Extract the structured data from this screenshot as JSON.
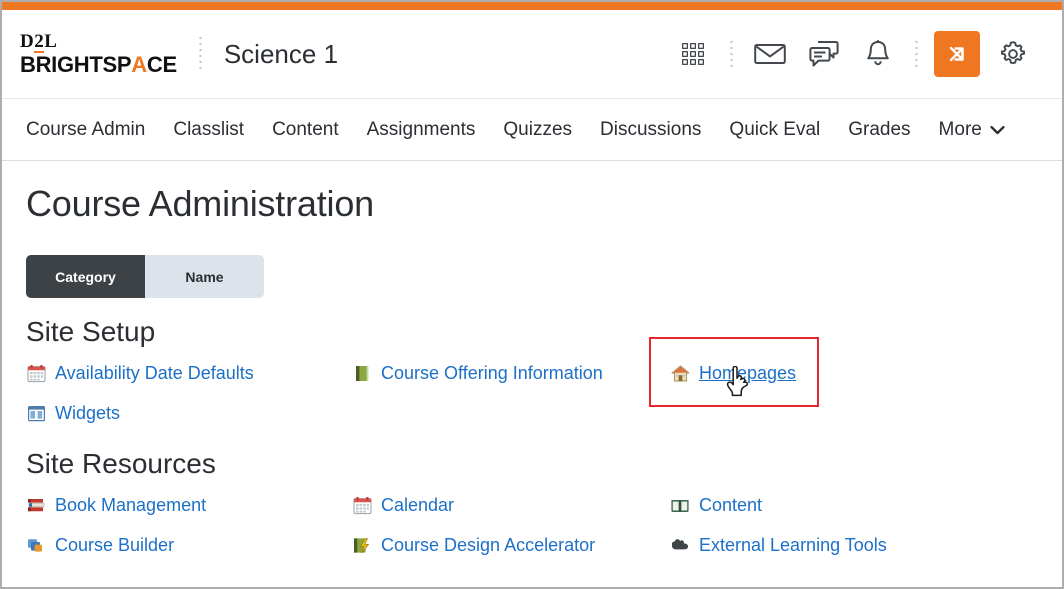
{
  "brand": {
    "logo_line1": "D2L",
    "logo_line2_a": "BRIGHTSP",
    "logo_line2_caret": "A",
    "logo_line2_b": "CE",
    "accent_color": "#ef7722",
    "link_color": "#1c70c8",
    "highlight_color": "#e8252a"
  },
  "header": {
    "course_title": "Science 1",
    "icons": [
      {
        "name": "waffle-grid-icon",
        "label": "Course selector"
      },
      {
        "name": "envelope-icon",
        "label": "Email"
      },
      {
        "name": "chat-bubbles-icon",
        "label": "Messages"
      },
      {
        "name": "bell-icon",
        "label": "Notifications"
      },
      {
        "name": "alerts-arrows-icon",
        "label": "Updates"
      },
      {
        "name": "gear-icon",
        "label": "Settings"
      }
    ]
  },
  "nav": {
    "items": [
      {
        "label": "Course Admin"
      },
      {
        "label": "Classlist"
      },
      {
        "label": "Content"
      },
      {
        "label": "Assignments"
      },
      {
        "label": "Quizzes"
      },
      {
        "label": "Discussions"
      },
      {
        "label": "Quick Eval"
      },
      {
        "label": "Grades"
      },
      {
        "label": "More"
      }
    ],
    "more_chevron": "chevron-down-icon"
  },
  "main": {
    "page_title": "Course Administration",
    "toggle": {
      "category_label": "Category",
      "name_label": "Name",
      "selected": "Category"
    },
    "sections": [
      {
        "heading": "Site Setup",
        "links": [
          {
            "label": "Availability Date Defaults",
            "icon": "calendar-icon",
            "hovered": false
          },
          {
            "label": "Course Offering Information",
            "icon": "green-book-icon",
            "hovered": false
          },
          {
            "label": "Homepages",
            "icon": "house-icon",
            "hovered": true
          },
          {
            "label": "Widgets",
            "icon": "widgets-icon",
            "hovered": false
          }
        ]
      },
      {
        "heading": "Site Resources",
        "links": [
          {
            "label": "Book Management",
            "icon": "book-stack-icon",
            "hovered": false
          },
          {
            "label": "Calendar",
            "icon": "calendar-icon",
            "hovered": false
          },
          {
            "label": "Content",
            "icon": "open-book-icon",
            "hovered": false
          },
          {
            "label": "Course Builder",
            "icon": "course-builder-icon",
            "hovered": false
          },
          {
            "label": "Course Design Accelerator",
            "icon": "book-bolt-icon",
            "hovered": false
          },
          {
            "label": "External Learning Tools",
            "icon": "puzzle-piece-icon",
            "hovered": false
          }
        ]
      }
    ]
  }
}
